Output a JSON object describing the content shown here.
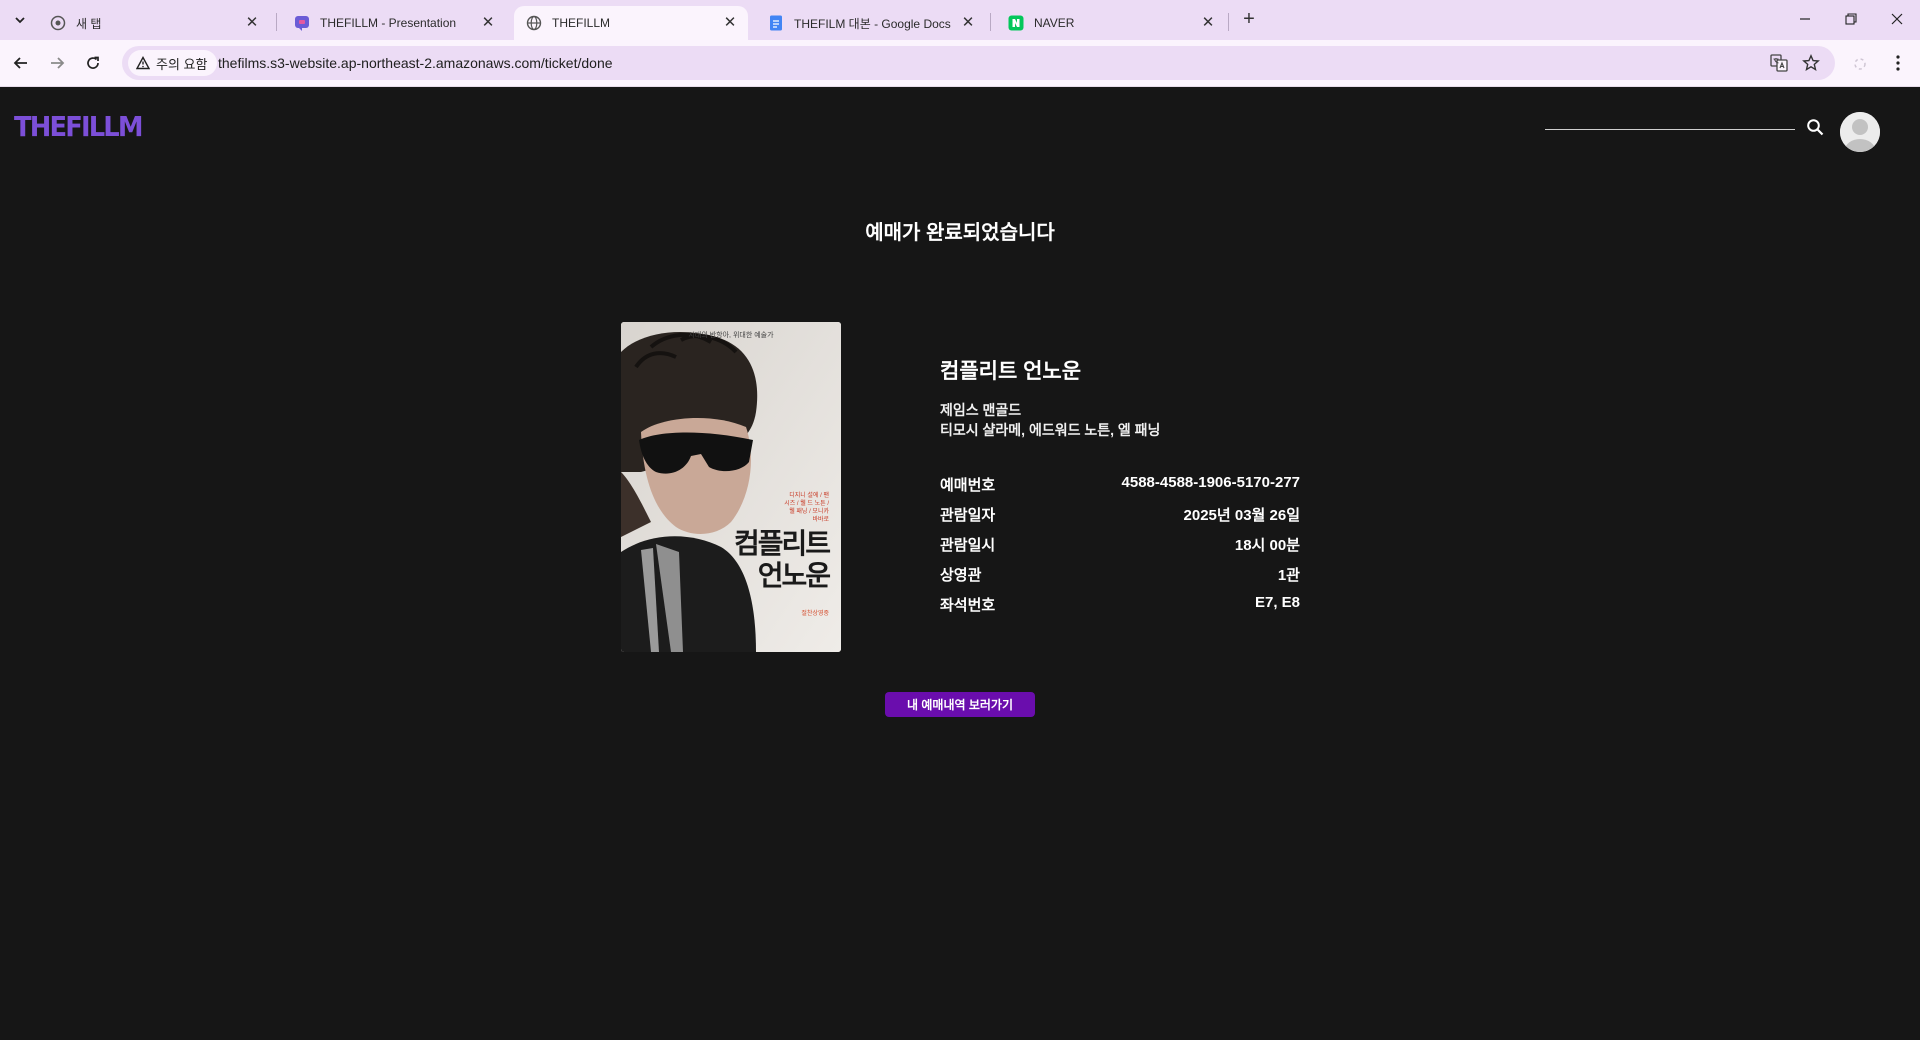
{
  "browser": {
    "tabs": [
      {
        "title": "새 탭",
        "active": false
      },
      {
        "title": "THEFILLM - Presentation",
        "active": false
      },
      {
        "title": "THEFILLM",
        "active": true
      },
      {
        "title": "THEFILM 대본 - Google Docs",
        "active": false
      },
      {
        "title": "NAVER",
        "active": false
      }
    ],
    "security_chip": "주의 요함",
    "url": "thefilms.s3-website.ap-northeast-2.amazonaws.com/ticket/done"
  },
  "site": {
    "logo": "THEFILLM",
    "search_placeholder": ""
  },
  "page": {
    "heading": "예매가 완료되었습니다"
  },
  "poster": {
    "tagline": "시대의 반항아, 위대한 예술가",
    "title_line1": "컴플리트",
    "title_line2": "언노운",
    "red_text": "디지니 설에 / 팬 시즈 / 웰 드 노튼 / 웰 패닝 / 모니카 바바로",
    "footer": "절찬상영중"
  },
  "movie": {
    "title": "컴플리트 언노운",
    "director": "제임스 맨골드",
    "cast": "티모시 샬라메, 에드워드 노튼, 엘 패닝"
  },
  "ticket": [
    {
      "label": "예매번호",
      "value": "4588-4588-1906-5170-277"
    },
    {
      "label": "관람일자",
      "value": "2025년 03월 26일"
    },
    {
      "label": "관람일시",
      "value": "18시 00분"
    },
    {
      "label": "상영관",
      "value": "1관"
    },
    {
      "label": "좌석번호",
      "value": "E7, E8"
    }
  ],
  "cta_label": "내 예매내역 보러가기"
}
